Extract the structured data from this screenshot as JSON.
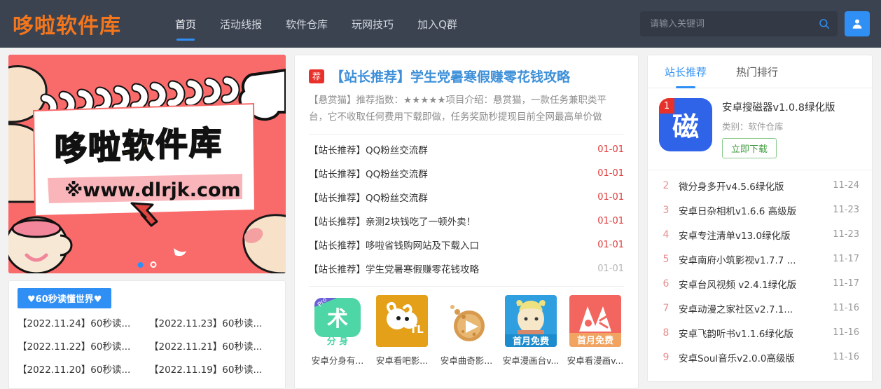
{
  "header": {
    "logo": "哆啦软件库",
    "nav": [
      {
        "label": "首页",
        "active": true
      },
      {
        "label": "活动线报",
        "active": false
      },
      {
        "label": "软件仓库",
        "active": false
      },
      {
        "label": "玩网技巧",
        "active": false
      },
      {
        "label": "加入Q群",
        "active": false
      }
    ],
    "search": {
      "placeholder": "请输入关键词",
      "value": "",
      "icon": "search-icon"
    },
    "user_button_icon": "user-icon",
    "accent_color": "#2f8ff5",
    "logo_color": "#f4761c",
    "bg_color": "#3b4351"
  },
  "banner": {
    "title": "哆啦软件库",
    "url_text": "※www.dlrjk.com",
    "bg_color": "#f96a6a",
    "dots": [
      {
        "active": true
      },
      {
        "active": false
      }
    ]
  },
  "sixty": {
    "title": "♥60秒读懂世界♥",
    "items": [
      "【2022.11.24】60秒读...",
      "【2022.11.23】60秒读...",
      "【2022.11.22】60秒读...",
      "【2022.11.21】60秒读...",
      "【2022.11.20】60秒读...",
      "【2022.11.19】60秒读..."
    ]
  },
  "featured": {
    "badge": "荐",
    "title": "【站长推荐】学生党暑寒假赚零花钱攻略",
    "desc": "【悬赏猫】推荐指数：★★★★★项目介绍：悬赏猫，一款任务兼职类平台，它不收取任何费用下载即做，任务奖励秒提现目前全网最高单价做"
  },
  "posts": [
    {
      "title": "【站长推荐】QQ粉丝交流群",
      "date": "01-01",
      "muted": false
    },
    {
      "title": "【站长推荐】QQ粉丝交流群",
      "date": "01-01",
      "muted": false
    },
    {
      "title": "【站长推荐】QQ粉丝交流群",
      "date": "01-01",
      "muted": false
    },
    {
      "title": "【站长推荐】亲测2块钱吃了一顿外卖！",
      "date": "01-01",
      "muted": false
    },
    {
      "title": "【站长推荐】哆啦省钱购网站及下载入口",
      "date": "01-01",
      "muted": false
    },
    {
      "title": "【站长推荐】学生党暑寒假赚零花钱攻略",
      "date": "01-01",
      "muted": true
    }
  ],
  "apps": [
    {
      "name": "安卓分身有...",
      "icon": "app-icon-fenshen",
      "badge": "Pro",
      "sub": "分身",
      "glyph": "术",
      "color": "#4ed6a6"
    },
    {
      "name": "安卓看吧影...",
      "icon": "app-icon-kanba",
      "glyph": "TL",
      "color": "#e3a018"
    },
    {
      "name": "安卓曲奇影...",
      "icon": "app-icon-quqi",
      "glyph": "▶",
      "color": "#ffffff"
    },
    {
      "name": "安卓漫画台v...",
      "icon": "app-icon-manhuatai",
      "sub": "首月免费",
      "color": "#2f9fe0"
    },
    {
      "name": "安卓看漫画v...",
      "icon": "app-icon-kanmanhua",
      "sub": "首月免费",
      "color": "#f3665f"
    }
  ],
  "sidebar": {
    "tabs": [
      {
        "label": "站长推荐",
        "active": true
      },
      {
        "label": "热门排行",
        "active": false
      }
    ],
    "top": {
      "rank": "1",
      "icon_glyph": "磁",
      "icon_color": "#2f63e8",
      "name": "安卓搜磁器v1.0.8绿化版",
      "category": "类别：软件仓库",
      "download_label": "立即下载"
    },
    "ranks": [
      {
        "num": "2",
        "title": "微分身多开v4.5.6绿化版",
        "date": "11-24"
      },
      {
        "num": "3",
        "title": "安卓日杂相机v1.6.6 高级版",
        "date": "11-23"
      },
      {
        "num": "4",
        "title": "安卓专注清单v13.0绿化版",
        "date": "11-23"
      },
      {
        "num": "5",
        "title": "安卓南府小筑影视v1.7.7 ...",
        "date": "11-17"
      },
      {
        "num": "6",
        "title": "安卓台风视频 v2.4.1绿化版",
        "date": "11-17"
      },
      {
        "num": "7",
        "title": "安卓动漫之家社区v2.7.1...",
        "date": "11-16"
      },
      {
        "num": "8",
        "title": "安卓飞韵听书v1.1.6绿化版",
        "date": "11-16"
      },
      {
        "num": "9",
        "title": "安卓Soul音乐v2.0.0高级版",
        "date": "11-16"
      }
    ]
  }
}
